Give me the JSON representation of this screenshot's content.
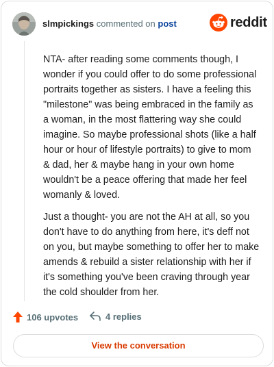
{
  "header": {
    "username": "slmpickings",
    "commented_text": "commented on",
    "post_link": "post",
    "brand": "reddit"
  },
  "comment": {
    "paragraphs": [
      "NTA- after reading some comments though, I wonder if you could offer to do some professional portraits together as sisters. I have a feeling this \"milestone\" was being embraced in the family as a woman, in the most flattering way she could imagine. So maybe professional shots (like a half hour or hour of lifestyle portraits) to give to mom & dad, her & maybe hang in your own home wouldn't be a peace offering that made her feel womanly & loved.",
      "Just a thought- you are not the AH at all, so you don't have to do anything from here, it's deff not on you, but maybe something to offer her to make amends & rebuild a sister relationship with her if it's something you've been craving through year the cold shoulder from her."
    ]
  },
  "footer": {
    "upvotes": "106 upvotes",
    "replies": "4 replies",
    "view_button": "View the conversation"
  },
  "colors": {
    "brand_orange": "#ff4500",
    "upvote_orange": "#ff4500",
    "link_blue": "#0a449b",
    "button_text": "#d93a00",
    "muted": "#576f76"
  },
  "icons": {
    "avatar": "user-avatar",
    "brand": "reddit-snoo-icon",
    "upvote": "upvote-arrow-icon",
    "reply": "reply-arrow-icon"
  }
}
